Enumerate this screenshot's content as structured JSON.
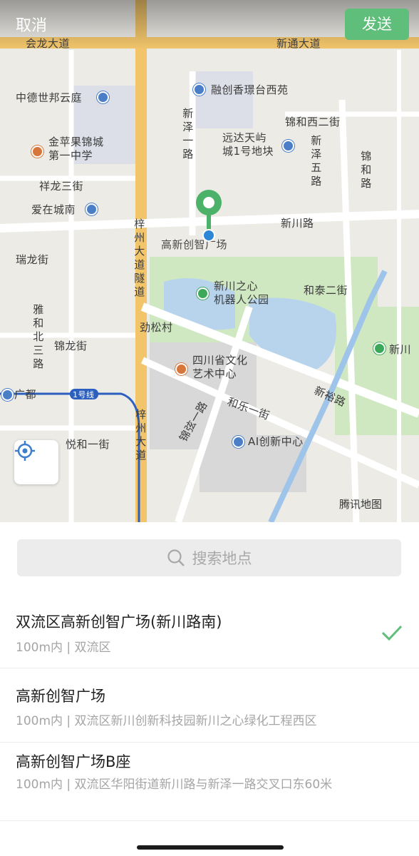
{
  "header": {
    "cancel_label": "取消",
    "send_label": "发送"
  },
  "map": {
    "labels": {
      "huilong": "会龙大道",
      "xintong": "新通大道",
      "zhongde": "中德世邦云庭",
      "rongchuang": "融创香璟台西苑",
      "jinhe": "锦和西二街",
      "jinpingguo": "金苹果锦城\n第一中学",
      "xiangzeyi": "新泽一路",
      "yuanda": "远达天屿\n城1号地块",
      "xinzewu": "新泽五路",
      "jinhe_lu": "锦和路",
      "xianglong": "祥龙三街",
      "aizai": "爱在城南",
      "xinchuan": "新川路",
      "zizhou": "梓州大道隧道",
      "gaoxin": "高新创智广场",
      "ruilong": "瑞龙街",
      "xinchuan_heart": "新川之心\n机器人公园",
      "hetai": "和泰二街",
      "yahebei": "雅和北三路",
      "jinsong": "劲松村",
      "jinlong": "锦龙街",
      "sichuan": "四川省文化\n艺术中心",
      "xinchuan_r": "新川",
      "xinyu": "新裕路",
      "guangdu": "广都",
      "line1": "1号线",
      "hele": "和乐一街",
      "jinxuan": "锦弦一路",
      "zizhou2": "梓州大道",
      "yuehe": "悦和一街",
      "ai_center": "AI创新中心",
      "brand": "腾讯地图"
    },
    "icons": {
      "pin": "location-pin-icon",
      "locate": "locate-target-icon",
      "poi": "poi-icon"
    },
    "colors": {
      "pin": "#4cb26a",
      "road_yellow": "#f2c56b",
      "water": "#b7d4ec",
      "park": "#cfe8c2"
    }
  },
  "search": {
    "placeholder": "搜索地点",
    "icon": "search-icon"
  },
  "results": [
    {
      "title": "双流区高新创智广场(新川路南)",
      "subtitle": "100m内 | 双流区",
      "selected": true
    },
    {
      "title": "高新创智广场",
      "subtitle": "100m内 | 双流区新川创新科技园新川之心绿化工程西区",
      "selected": false
    },
    {
      "title": "高新创智广场B座",
      "subtitle": "100m内 | 双流区华阳街道新川路与新泽一路交叉口东60米",
      "selected": false
    }
  ],
  "check_color": "#5fbe7a"
}
